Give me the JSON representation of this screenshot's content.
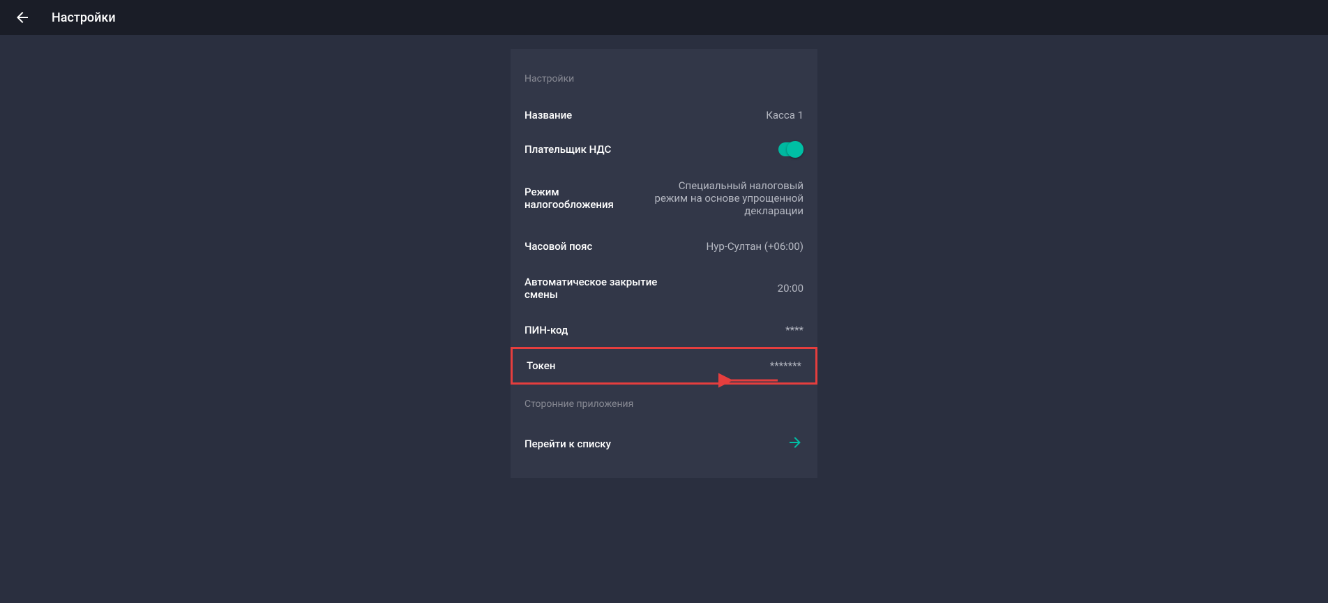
{
  "header": {
    "title": "Настройки"
  },
  "panel": {
    "section_title": "Настройки",
    "rows": {
      "name": {
        "label": "Название",
        "value": "Касса 1"
      },
      "vat_payer": {
        "label": "Плательщик НДС",
        "toggle_on": true
      },
      "tax_mode": {
        "label": "Режим налогообложения",
        "value": "Специальный налоговый режим на основе упрощенной декларации"
      },
      "timezone": {
        "label": "Часовой пояс",
        "value": "Нур-Султан (+06:00)"
      },
      "auto_close": {
        "label": "Автоматическое закрытие смены",
        "value": "20:00"
      },
      "pin": {
        "label": "ПИН-код",
        "value": "****"
      },
      "token": {
        "label": "Токен",
        "value": "*******"
      }
    },
    "external_apps": {
      "section_title": "Сторонние приложения",
      "go_to_list": "Перейти к списку"
    }
  }
}
